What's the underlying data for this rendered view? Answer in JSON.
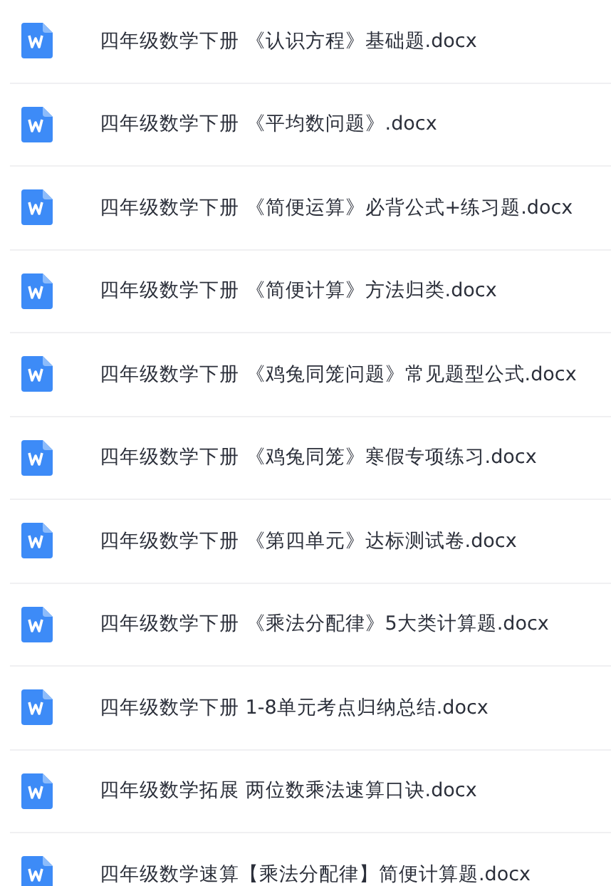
{
  "files": [
    {
      "name": "四年级数学下册 《认识方程》基础题.docx"
    },
    {
      "name": "四年级数学下册 《平均数问题》.docx"
    },
    {
      "name": "四年级数学下册 《简便运算》必背公式+练习题.docx"
    },
    {
      "name": "四年级数学下册 《简便计算》方法归类.docx"
    },
    {
      "name": "四年级数学下册 《鸡兔同笼问题》常见题型公式.docx"
    },
    {
      "name": "四年级数学下册 《鸡兔同笼》寒假专项练习.docx"
    },
    {
      "name": "四年级数学下册 《第四单元》达标测试卷.docx"
    },
    {
      "name": "四年级数学下册 《乘法分配律》5大类计算题.docx"
    },
    {
      "name": "四年级数学下册 1-8单元考点归纳总结.docx"
    },
    {
      "name": "四年级数学拓展 两位数乘法速算口诀.docx"
    },
    {
      "name": "四年级数学速算【乘法分配律】简便计算题.docx"
    }
  ]
}
